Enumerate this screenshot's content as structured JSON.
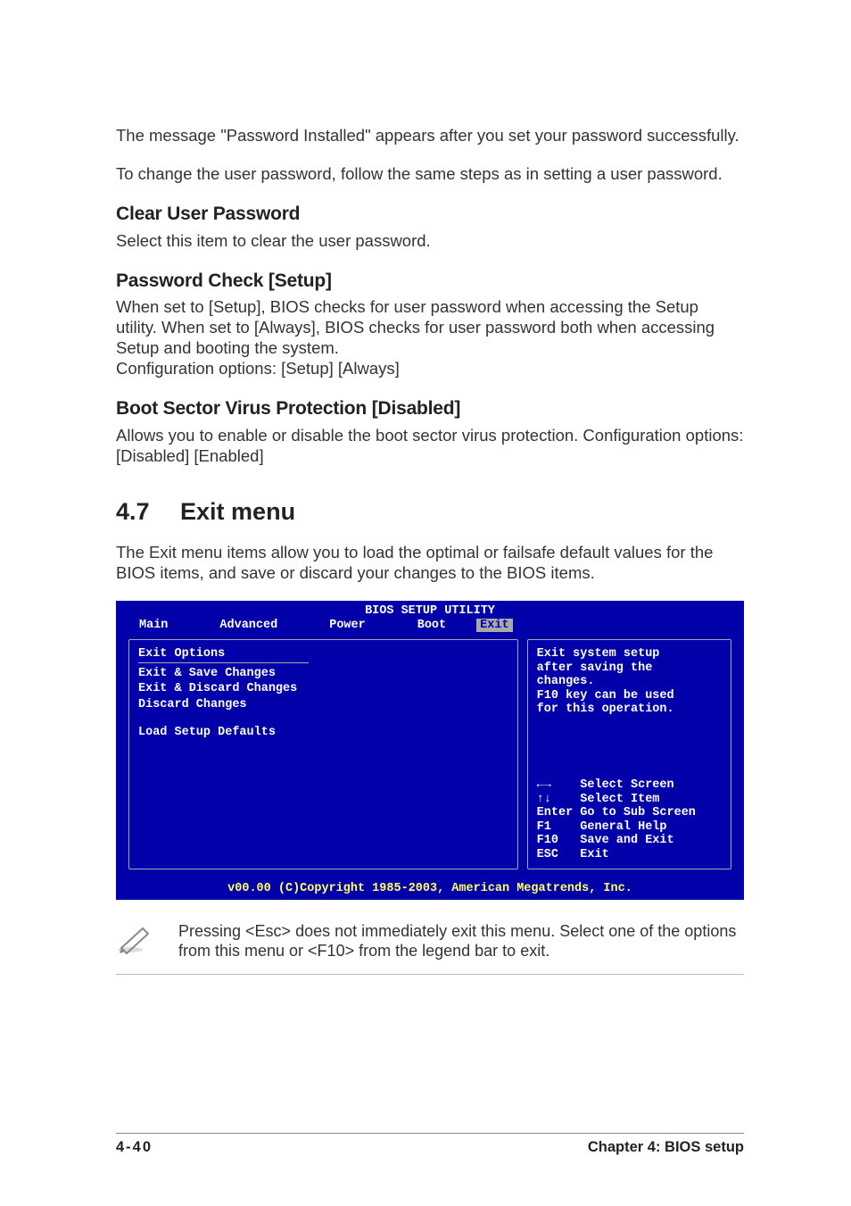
{
  "body": {
    "p1": "The message \"Password Installed\" appears after you set your password successfully.",
    "p2": "To change the user password, follow the same steps as in setting a user password.",
    "h_clear": "Clear User Password",
    "p_clear": "Select this item to clear the user password.",
    "h_pwcheck": "Password Check [Setup]",
    "p_pwcheck": "When set to [Setup], BIOS checks for user password when accessing the Setup utility. When set to [Always], BIOS checks for user password both when accessing Setup and booting the system.\nConfiguration options: [Setup] [Always]",
    "h_bootsect": "Boot Sector Virus Protection [Disabled]",
    "p_bootsect": "Allows you to enable or disable the boot sector virus protection. Configuration options: [Disabled] [Enabled]",
    "h_section": "4.7  Exit menu",
    "p_section": "The Exit menu items allow you to load the optimal or failsafe default values for the BIOS items, and save or discard your changes to the BIOS items."
  },
  "bios": {
    "title": "BIOS SETUP UTILITY",
    "tabs": {
      "t0": "Main",
      "t1": "Advanced",
      "t2": "Power",
      "t3": "Boot",
      "t4": "Exit"
    },
    "left_heading": "Exit Options",
    "items": {
      "i0": "Exit & Save Changes",
      "i1": "Exit & Discard Changes",
      "i2": "Discard Changes",
      "i3": "Load Setup Defaults"
    },
    "right_help": "Exit system setup\nafter saving the\nchanges.\nF10 key can be used\nfor this operation.",
    "legend": {
      "l0": "←→    Select Screen",
      "l1": "↑↓    Select Item",
      "l2": "Enter Go to Sub Screen",
      "l3": "F1    General Help",
      "l4": "F10   Save and Exit",
      "l5": "ESC   Exit"
    },
    "footer": "v00.00 (C)Copyright 1985-2003, American Megatrends, Inc."
  },
  "note": "Pressing <Esc> does not immediately exit this menu. Select one of the options from this menu or <F10> from the legend bar to exit.",
  "page_footer": {
    "left": "4-40",
    "right": "Chapter 4: BIOS setup"
  }
}
